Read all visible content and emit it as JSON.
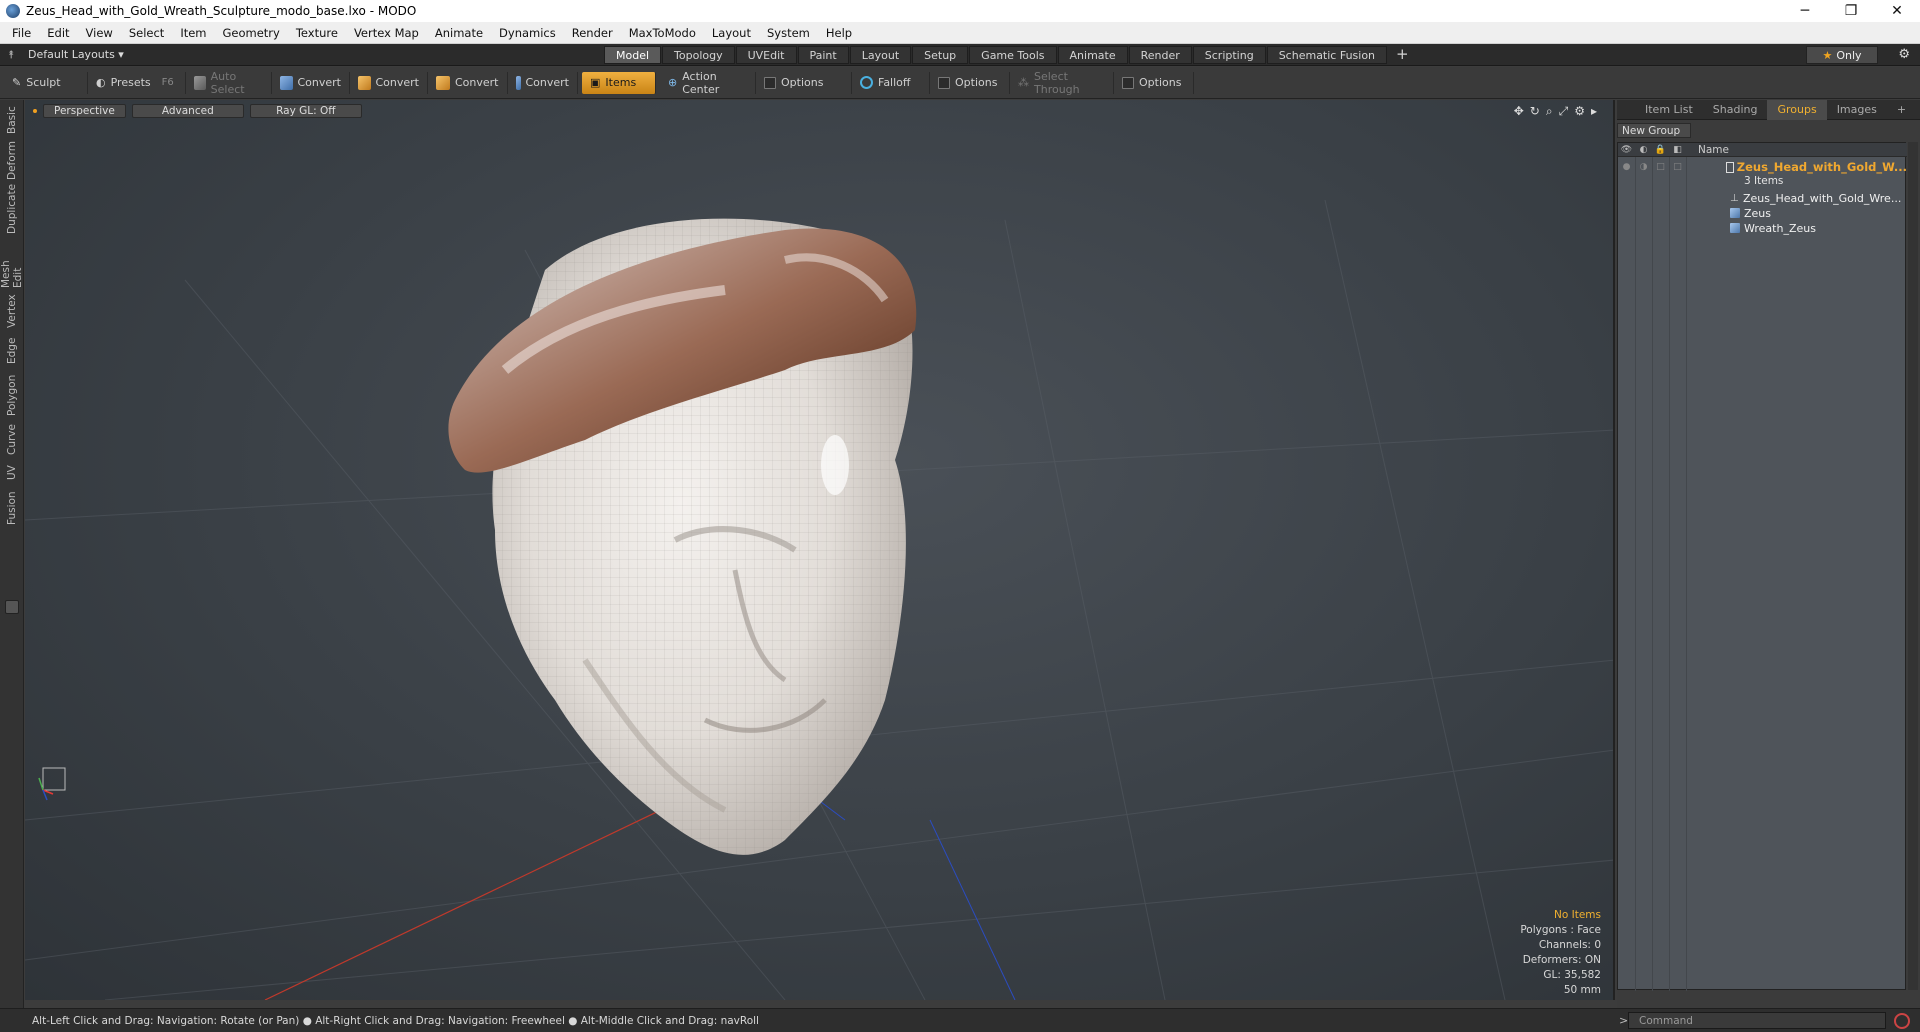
{
  "window": {
    "title": "Zeus_Head_with_Gold_Wreath_Sculpture_modo_base.lxo - MODO",
    "minimize": "─",
    "maximize": "❐",
    "close": "✕"
  },
  "menu": [
    "File",
    "Edit",
    "View",
    "Select",
    "Item",
    "Geometry",
    "Texture",
    "Vertex Map",
    "Animate",
    "Dynamics",
    "Render",
    "MaxToModo",
    "Layout",
    "System",
    "Help"
  ],
  "layoutbar": {
    "layout_selector": "Default Layouts ▾",
    "tabs": [
      "Model",
      "Topology",
      "UVEdit",
      "Paint",
      "Layout",
      "Setup",
      "Game Tools",
      "Animate",
      "Render",
      "Scripting",
      "Schematic Fusion"
    ],
    "active_tab": "Model",
    "plus": "+",
    "only_label": "Only",
    "star": "★",
    "gear": "⚙"
  },
  "toolbar": {
    "sculpt": "Sculpt",
    "presets": "Presets",
    "presets_hotkey": "F6",
    "auto_select": "Auto Select",
    "convert1": "Convert",
    "convert2": "Convert",
    "convert3": "Convert",
    "convert4": "Convert",
    "items": "Items",
    "action_center": "Action Center",
    "options1": "Options",
    "falloff": "Falloff",
    "options2": "Options",
    "select_through": "Select Through",
    "options3": "Options"
  },
  "lefttabs": [
    "Basic",
    "Deform",
    "Duplicate",
    "Mesh Edit",
    "Vertex",
    "Edge",
    "Polygon",
    "Curve",
    "UV",
    "Fusion"
  ],
  "viewport": {
    "perspective": "Perspective",
    "advanced": "Advanced",
    "raygl": "Ray GL: Off",
    "icons": [
      "✥",
      "↻",
      "⌕",
      "⤢",
      "⚙",
      "▸"
    ],
    "stats": {
      "no_items": "No Items",
      "polygons": "Polygons : Face",
      "channels": "Channels: 0",
      "deformers": "Deformers: ON",
      "gl": "GL: 35,582",
      "scale": "50 mm"
    }
  },
  "rightpanel": {
    "tabs": [
      "Item List",
      "Shading",
      "Groups",
      "Images",
      "+"
    ],
    "active_tab": "Groups",
    "new_group": "New Group",
    "column_name": "Name",
    "group_name": "Zeus_Head_with_Gold_W...",
    "group_count": "3 Items",
    "children": [
      "Zeus_Head_with_Gold_Wre...",
      "Zeus",
      "Wreath_Zeus"
    ]
  },
  "statusbar": {
    "text": "Alt-Left Click and Drag: Navigation: Rotate (or Pan) ● Alt-Right Click and Drag: Navigation: Freewheel ● Alt-Middle Click and Drag: navRoll",
    "command_prompt": ">",
    "command_placeholder": "Command"
  }
}
